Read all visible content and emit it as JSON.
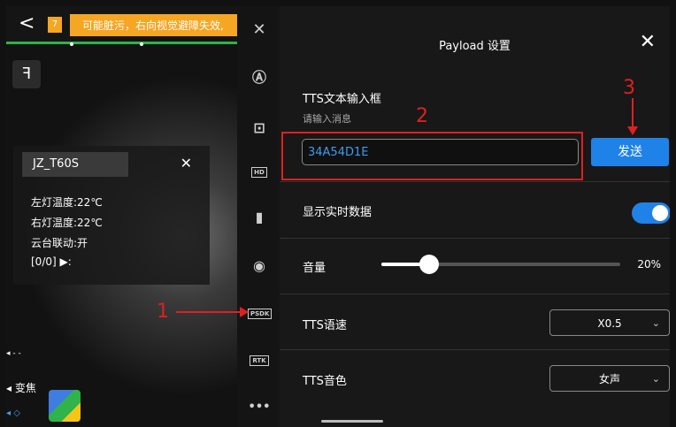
{
  "camera": {
    "back_glyph": "<",
    "alert_badge": "7",
    "alert_text": "可能脏污，右向视觉避障失效,",
    "logo_icon": "drone-logo-icon",
    "info_panel": {
      "device_name": "JZ_T60S",
      "close_glyph": "✕",
      "left_temp": "左灯温度:22℃",
      "right_temp": "右灯温度:22℃",
      "gimbal_link": "云台联动:开",
      "playback": "[0/0] ▶:"
    },
    "footer": {
      "dash": "◂ - -",
      "zoom": "◂ 变焦",
      "extra": "◂ ◇"
    }
  },
  "sidebar": {
    "items": [
      {
        "icon": "propeller-icon",
        "glyph": "✕"
      },
      {
        "icon": "mode-icon",
        "glyph": "Ⓐ"
      },
      {
        "icon": "drone-icon",
        "glyph": "⊡"
      },
      {
        "icon": "hd-icon",
        "glyph": "HD"
      },
      {
        "icon": "battery-icon",
        "glyph": "▮"
      },
      {
        "icon": "camera-icon",
        "glyph": "◉"
      },
      {
        "icon": "psdk-icon",
        "glyph": "PSDK"
      },
      {
        "icon": "rtk-icon",
        "glyph": "RTK"
      },
      {
        "icon": "more-icon",
        "glyph": "•••"
      }
    ]
  },
  "panel": {
    "title": "Payload 设置",
    "close_glyph": "✕",
    "tts_label": "TTS文本输入框",
    "tts_hint": "请输入消息",
    "tts_value": "34A54D1E",
    "send_label": "发送",
    "realtime_label": "显示实时数据",
    "realtime_on": true,
    "volume_label": "音量",
    "volume_value": "20%",
    "volume_fraction": 0.2,
    "speed_label": "TTS语速",
    "speed_value": "X0.5",
    "voice_label": "TTS音色",
    "voice_value": "女声"
  },
  "annotations": {
    "one": "1",
    "two": "2",
    "three": "3"
  },
  "colors": {
    "accent": "#1e82e8",
    "alert": "#f5a623",
    "annotation": "#e02020",
    "green": "#2fb34a"
  }
}
